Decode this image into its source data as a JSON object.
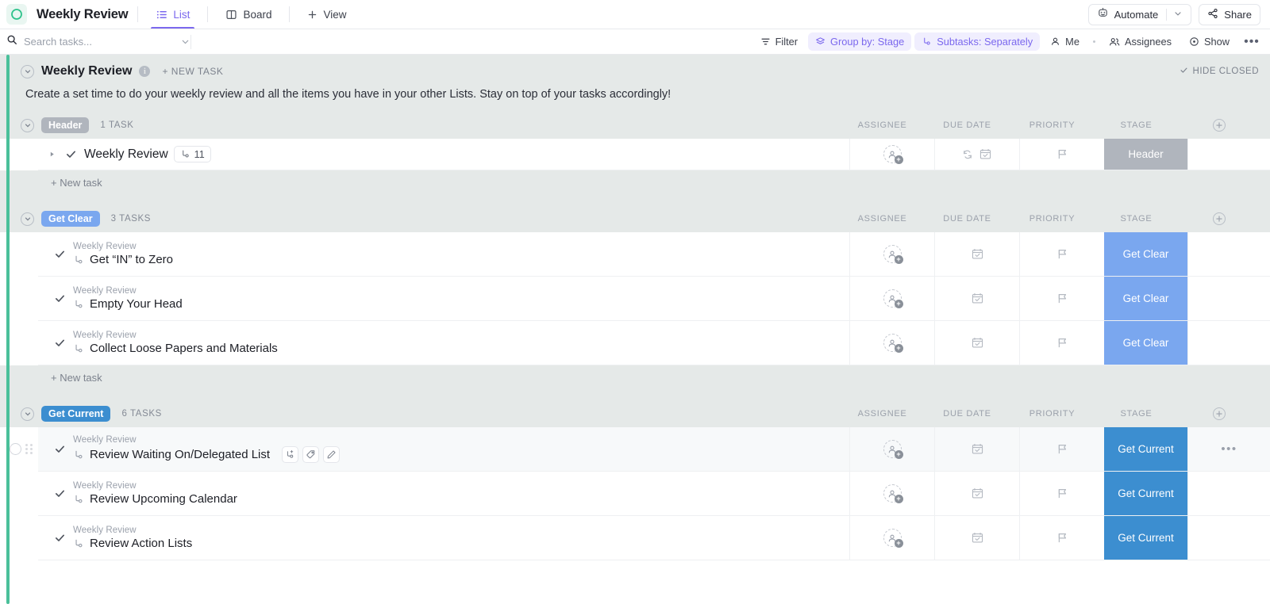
{
  "topbar": {
    "workspace_icon": "circle-logo-icon",
    "view_title": "Weekly Review",
    "tabs": [
      {
        "label": "List",
        "icon": "list-icon",
        "active": true
      },
      {
        "label": "Board",
        "icon": "board-icon",
        "active": false
      }
    ],
    "add_view_label": "View",
    "automate_label": "Automate",
    "share_label": "Share"
  },
  "filterbar": {
    "search_placeholder": "Search tasks...",
    "search_value": "",
    "filter_label": "Filter",
    "group_by_label": "Group by: Stage",
    "subtasks_label": "Subtasks: Separately",
    "me_label": "Me",
    "assignees_label": "Assignees",
    "show_label": "Show",
    "more_label": "•••"
  },
  "list": {
    "accent_color": "#4ac09a",
    "name": "Weekly Review",
    "new_task_label": "+ NEW TASK",
    "hide_closed_label": "HIDE CLOSED",
    "description": "Create a set time to do your weekly review and all the items you have in your other Lists. Stay on top of your tasks accordingly!"
  },
  "columns": {
    "assignee": "ASSIGNEE",
    "due_date": "DUE DATE",
    "priority": "PRIORITY",
    "stage": "STAGE"
  },
  "new_task_row_label": "+ New task",
  "groups": [
    {
      "name": "Header",
      "badge_color": "#b0b5bd",
      "count_label": "1 TASK",
      "has_new_task_row": true,
      "tasks": [
        {
          "parent": "",
          "name": "Weekly Review",
          "subtask_count": "11",
          "has_expand_arrow": true,
          "has_subtask_icon": false,
          "has_recurring_icon": true,
          "stage": "Header",
          "stage_color": "#b0b5bd",
          "hovered": false
        }
      ]
    },
    {
      "name": "Get Clear",
      "badge_color": "#7aa7ef",
      "count_label": "3 TASKS",
      "has_new_task_row": true,
      "tasks": [
        {
          "parent": "Weekly Review",
          "name": "Get “IN” to Zero",
          "subtask_count": "",
          "has_expand_arrow": false,
          "has_subtask_icon": true,
          "has_recurring_icon": false,
          "stage": "Get Clear",
          "stage_color": "#7aa7ef",
          "hovered": false
        },
        {
          "parent": "Weekly Review",
          "name": "Empty Your Head",
          "subtask_count": "",
          "has_expand_arrow": false,
          "has_subtask_icon": true,
          "has_recurring_icon": false,
          "stage": "Get Clear",
          "stage_color": "#7aa7ef",
          "hovered": false
        },
        {
          "parent": "Weekly Review",
          "name": "Collect Loose Papers and Materials",
          "subtask_count": "",
          "has_expand_arrow": false,
          "has_subtask_icon": true,
          "has_recurring_icon": false,
          "stage": "Get Clear",
          "stage_color": "#7aa7ef",
          "hovered": false
        }
      ]
    },
    {
      "name": "Get Current",
      "badge_color": "#3c8ed0",
      "count_label": "6 TASKS",
      "has_new_task_row": false,
      "tasks": [
        {
          "parent": "Weekly Review",
          "name": "Review Waiting On/Delegated List",
          "subtask_count": "",
          "has_expand_arrow": false,
          "has_subtask_icon": true,
          "has_recurring_icon": false,
          "stage": "Get Current",
          "stage_color": "#3c8ed0",
          "hovered": true
        },
        {
          "parent": "Weekly Review",
          "name": "Review Upcoming Calendar",
          "subtask_count": "",
          "has_expand_arrow": false,
          "has_subtask_icon": true,
          "has_recurring_icon": false,
          "stage": "Get Current",
          "stage_color": "#3c8ed0",
          "hovered": false
        },
        {
          "parent": "Weekly Review",
          "name": "Review Action Lists",
          "subtask_count": "",
          "has_expand_arrow": false,
          "has_subtask_icon": true,
          "has_recurring_icon": false,
          "stage": "Get Current",
          "stage_color": "#3c8ed0",
          "hovered": false
        }
      ]
    }
  ]
}
